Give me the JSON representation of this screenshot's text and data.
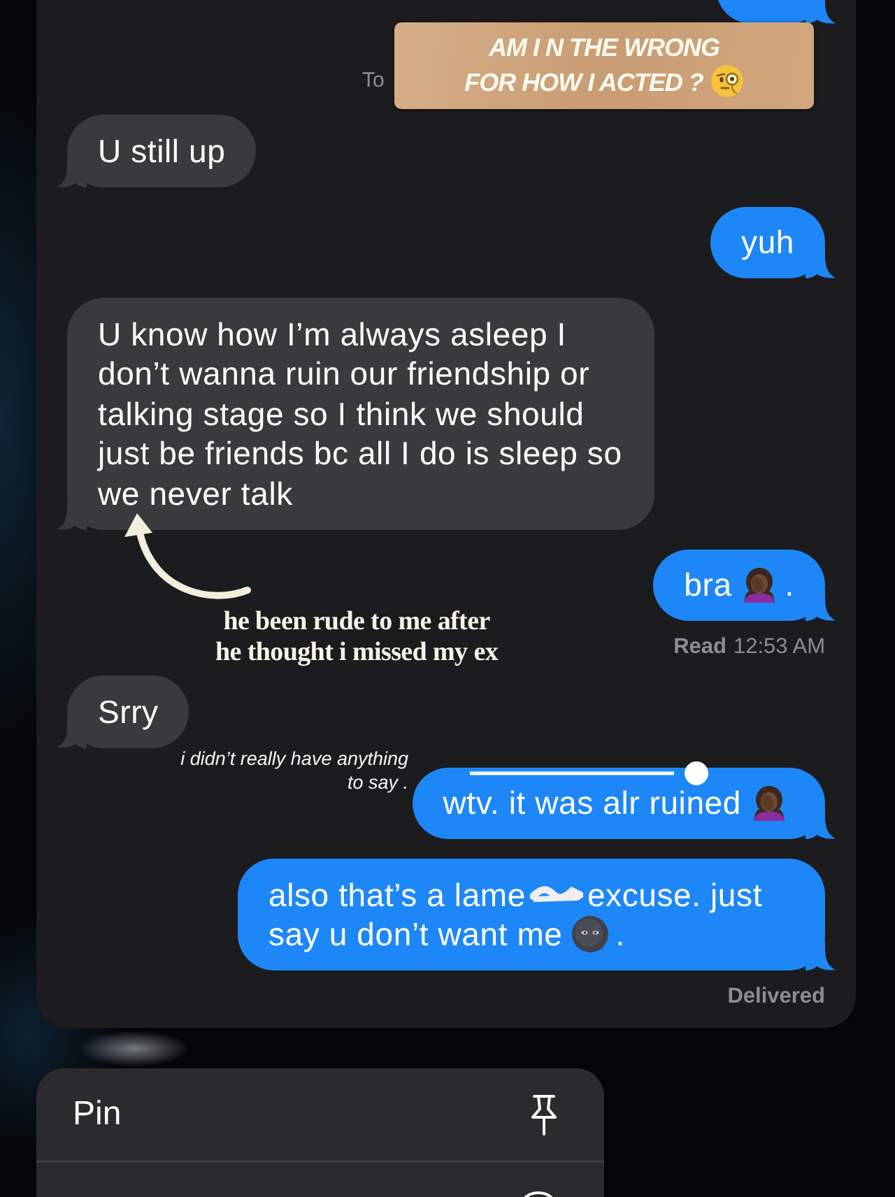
{
  "conversation": {
    "messages": [
      {
        "kind": "sent"
      },
      {
        "kind": "timestamp",
        "text": "To"
      },
      {
        "kind": "received",
        "parts": [
          {
            "kind": "text",
            "text": "U still up"
          }
        ]
      },
      {
        "kind": "sent",
        "parts": [
          {
            "kind": "text",
            "text": "yuh"
          }
        ]
      },
      {
        "kind": "received",
        "parts": [
          {
            "kind": "text",
            "text": "U know how I’m always asleep I don’t wanna ruin our friendship or talking stage so I think we should just be friends bc all I do is sleep so we never talk"
          }
        ]
      },
      {
        "kind": "sent",
        "parts": [
          {
            "kind": "text",
            "text": "bra"
          },
          {
            "kind": "facepalm"
          },
          {
            "kind": "text",
            "text": "."
          }
        ]
      },
      {
        "kind": "receipt",
        "label": "Read",
        "time": "12:53 AM"
      },
      {
        "kind": "received",
        "parts": [
          {
            "kind": "text",
            "text": "Srry"
          }
        ]
      },
      {
        "kind": "sent",
        "parts": [
          {
            "kind": "text",
            "text": "wtv. it was alr ruined"
          },
          {
            "kind": "facepalm"
          }
        ]
      },
      {
        "kind": "sent",
        "parts": [
          {
            "kind": "text",
            "text": "also that’s a lame"
          },
          {
            "kind": "scribble"
          },
          {
            "kind": "text",
            "text": "excuse. just"
          },
          {
            "kind": "text",
            "text": "say u don’t want me"
          },
          {
            "kind": "moonface"
          },
          {
            "kind": "text",
            "text": "."
          }
        ]
      },
      {
        "kind": "receipt",
        "label": "Delivered"
      }
    ]
  },
  "sticker": {
    "text": "AM I N THE WRONG\nFOR HOW I ACTED ?"
  },
  "annotations": [
    {
      "kind": "arrow-note",
      "text": "he been rude to me after\nhe thought i missed my ex"
    },
    {
      "kind": "line-note",
      "text": "i didn’t really have anything\nto say ."
    }
  ],
  "context_menu": {
    "items": [
      {
        "kind": "pin",
        "label": "Pin"
      },
      {
        "kind": "read"
      }
    ]
  }
}
